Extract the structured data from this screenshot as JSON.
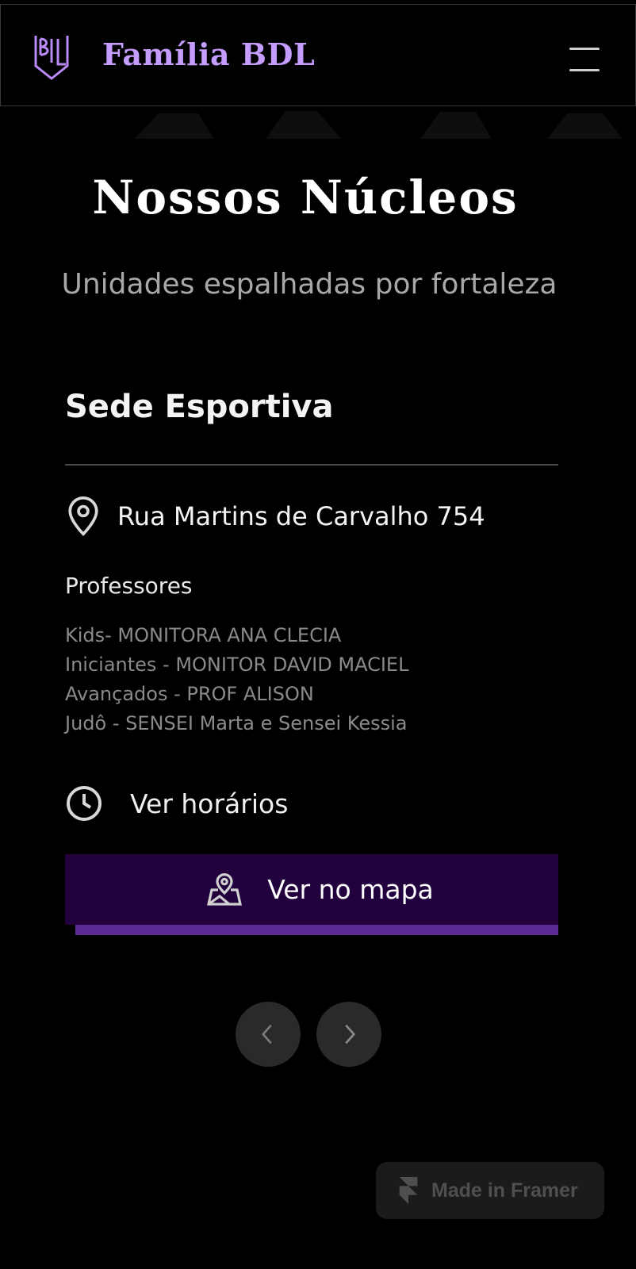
{
  "header": {
    "logo_text": "BDL",
    "brand": "Família BDL",
    "menu_icon": "hamburger-menu-icon"
  },
  "hero": {
    "title": "Nossos Núcleos",
    "subtitle": "Unidades espalhadas por fortaleza"
  },
  "card": {
    "title": "Sede Esportiva",
    "address_icon": "map-pin-icon",
    "address": "Rua Martins de Carvalho 754",
    "teachers_label": "Professores",
    "teachers": [
      "Kids- MONITORA ANA CLECIA",
      "Iniciantes - MONITOR DAVID MACIEL",
      "Avançados - PROF ALISON",
      "Judô - SENSEI Marta e Sensei Kessia"
    ],
    "hours_icon": "clock-icon",
    "hours_label": "Ver horários",
    "map_icon": "map-location-icon",
    "map_button_label": "Ver no mapa"
  },
  "carousel": {
    "prev_icon": "chevron-left-icon",
    "next_icon": "chevron-right-icon"
  },
  "badge": {
    "icon": "framer-icon",
    "label": "Made in Framer"
  },
  "colors": {
    "background": "#000000",
    "brand_purple": "#c59cff",
    "button_bg": "#22003d",
    "button_shadow": "#5a2c93",
    "muted_text": "#8a8a8a"
  }
}
